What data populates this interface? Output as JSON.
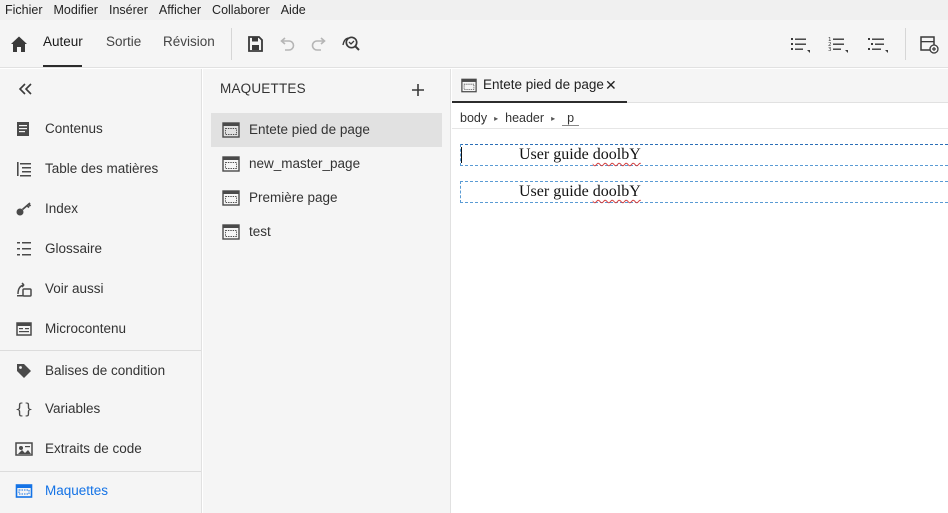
{
  "menubar": {
    "items": [
      {
        "label": "Fichier"
      },
      {
        "label": "Modifier"
      },
      {
        "label": "Insérer"
      },
      {
        "label": "Afficher"
      },
      {
        "label": "Collaborer"
      },
      {
        "label": "Aide"
      }
    ]
  },
  "toolbar": {
    "home_icon": "home-icon",
    "tabs": [
      {
        "label": "Auteur",
        "active": true
      },
      {
        "label": "Sortie",
        "active": false
      },
      {
        "label": "Révision",
        "active": false
      }
    ],
    "actions": [
      "save-icon",
      "undo-icon",
      "redo-icon",
      "search-replace-icon"
    ],
    "list_actions": [
      "bulleted-list-icon",
      "numbered-list-icon",
      "multilevel-list-icon"
    ],
    "right_action": "properties-panel-icon"
  },
  "leftnav": {
    "collapse_icon": "double-chevron-left-icon",
    "items": [
      {
        "label": "Contenus",
        "icon": "contents-icon"
      },
      {
        "label": "Table des matières",
        "icon": "toc-icon"
      },
      {
        "label": "Index",
        "icon": "index-key-icon"
      },
      {
        "label": "Glossaire",
        "icon": "glossary-icon"
      },
      {
        "label": "Voir aussi",
        "icon": "see-also-icon"
      },
      {
        "label": "Microcontenu",
        "icon": "microcontent-icon"
      },
      {
        "label": "Balises de condition",
        "icon": "tag-icon"
      },
      {
        "label": "Variables",
        "icon": "braces-icon"
      },
      {
        "label": "Extraits de code",
        "icon": "snippet-icon"
      },
      {
        "label": "Maquettes",
        "icon": "template-icon",
        "selected": true
      }
    ]
  },
  "midpanel": {
    "title": "MAQUETTES",
    "add_icon": "plus-icon",
    "items": [
      {
        "label": "Entete pied de page",
        "selected": true
      },
      {
        "label": "new_master_page"
      },
      {
        "label": "Première page"
      },
      {
        "label": "test"
      }
    ]
  },
  "editor": {
    "tab": {
      "label": "Entete pied de page",
      "close": "✕"
    },
    "breadcrumb": [
      "body",
      "header",
      "p"
    ],
    "breadcrumb_sep": "▸",
    "paragraphs": [
      {
        "text_plain": "User guide ",
        "text_flag": "doolbY"
      },
      {
        "text_plain": "User guide ",
        "text_flag": "doolbY"
      }
    ]
  },
  "colors": {
    "accent": "#1473e6",
    "panel_bg": "#f5f5f5",
    "selected_bg": "#e1e1e1",
    "guide_border": "#5a9bd4"
  }
}
